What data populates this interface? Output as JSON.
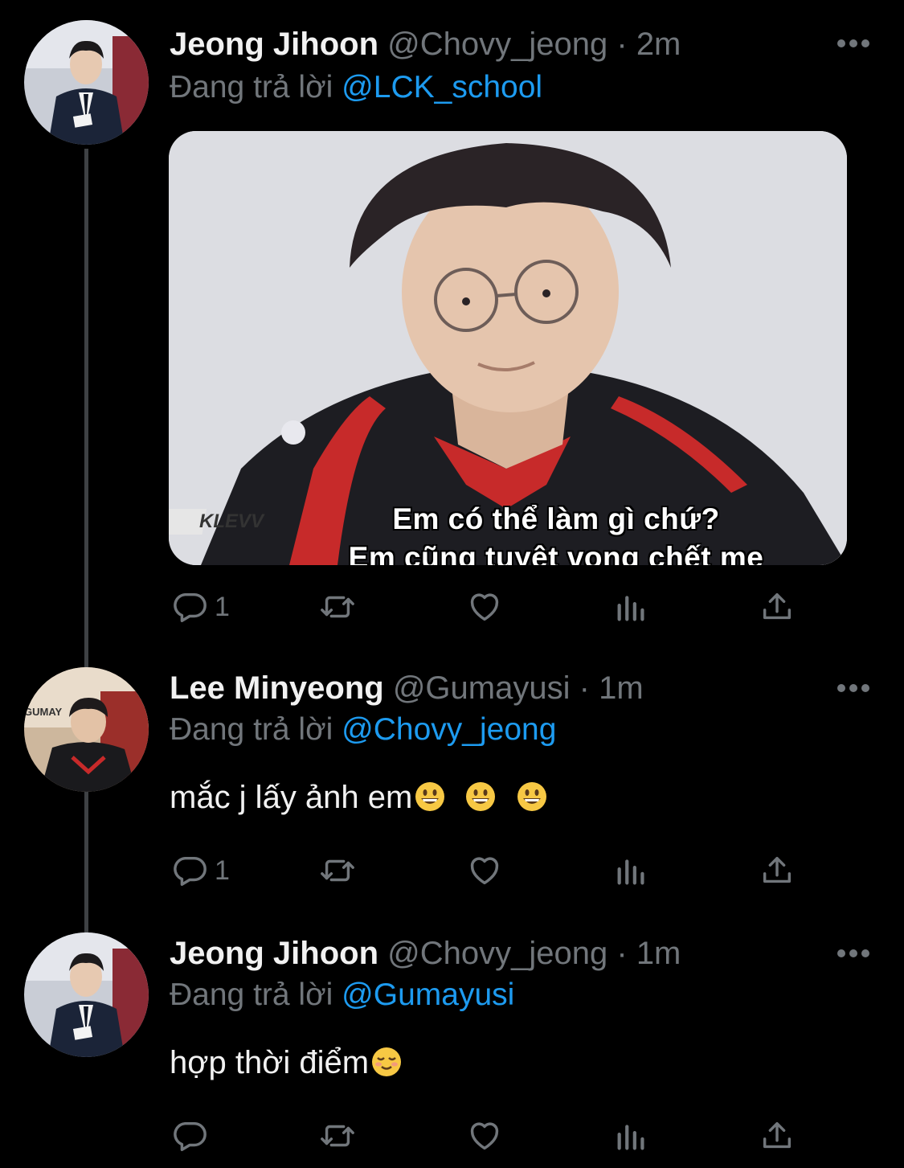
{
  "tweets": [
    {
      "name": "Jeong Jihoon",
      "handle": "@Chovy_jeong",
      "separator": "·",
      "time": "2m",
      "reply_prefix": "Đang trả lời",
      "reply_to": "@LCK_school",
      "media": {
        "caption_line1": "Em có thể làm gì chứ?",
        "caption_line2": "Em cũng tuyệt vọng chết mẹ",
        "logo_text": "KLEVV"
      },
      "reply_count": "1"
    },
    {
      "name": "Lee Minyeong",
      "handle": "@Gumayusi",
      "separator": "·",
      "time": "1m",
      "reply_prefix": "Đang trả lời",
      "reply_to": "@Chovy_jeong",
      "text": "mắc j lấy ảnh em",
      "reply_count": "1",
      "avatar_text": "GUMAY"
    },
    {
      "name": "Jeong Jihoon",
      "handle": "@Chovy_jeong",
      "separator": "·",
      "time": "1m",
      "reply_prefix": "Đang trả lời",
      "reply_to": "@Gumayusi",
      "text": "hợp thời điểm",
      "reply_count": ""
    }
  ],
  "icons": [
    "reply-icon",
    "retweet-icon",
    "like-icon",
    "analytics-icon",
    "share-icon",
    "more-icon"
  ],
  "colors": {
    "background": "#000000",
    "text": "#f1f1f1",
    "secondary": "#71767b",
    "link": "#1d9bf0",
    "thread": "#3e4144"
  }
}
